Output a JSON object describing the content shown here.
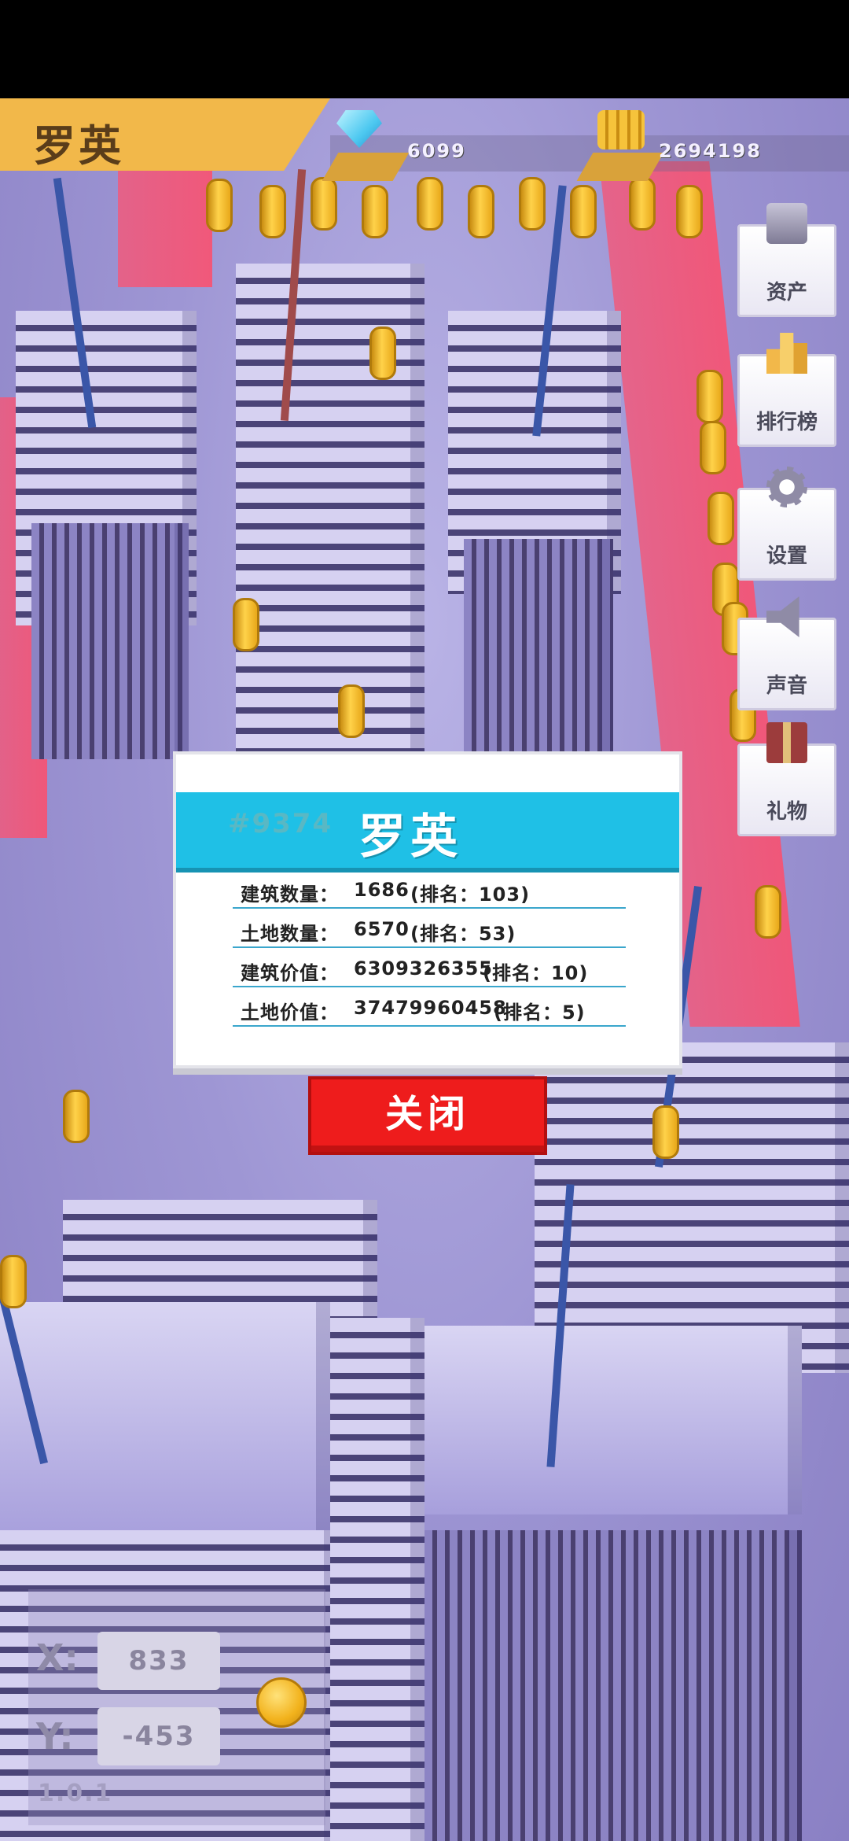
{
  "header": {
    "player_name": "罗英",
    "gems": "6099",
    "coins": "2694198"
  },
  "side_menu": [
    {
      "label": "资产",
      "icon": "assets-icon"
    },
    {
      "label": "排行榜",
      "icon": "leaderboard-icon"
    },
    {
      "label": "设置",
      "icon": "gear-icon"
    },
    {
      "label": "声音",
      "icon": "speaker-icon"
    },
    {
      "label": "礼物",
      "icon": "gift-icon"
    }
  ],
  "dialog": {
    "player_id": "#9374",
    "player_name": "罗英",
    "stats": [
      {
        "label": "建筑数量：",
        "value": "1686",
        "rank": "(排名：103)"
      },
      {
        "label": "土地数量：",
        "value": "6570",
        "rank": "(排名：53)"
      },
      {
        "label": "建筑价值：",
        "value": "6309326355",
        "rank": "(排名：10)"
      },
      {
        "label": "土地价值：",
        "value": "37479960458",
        "rank": "(排名：5)"
      }
    ],
    "close_label": "关闭"
  },
  "coords": {
    "x_label": "X:",
    "x_value": "833",
    "y_label": "Y:",
    "y_value": "-453"
  },
  "version": "1.0.1",
  "colors": {
    "banner": "#f2b84a",
    "dialog_header": "#1fc0e6",
    "close_button": "#ee1c1c",
    "city": "#9e96d4",
    "road": "#ff4d6a"
  }
}
